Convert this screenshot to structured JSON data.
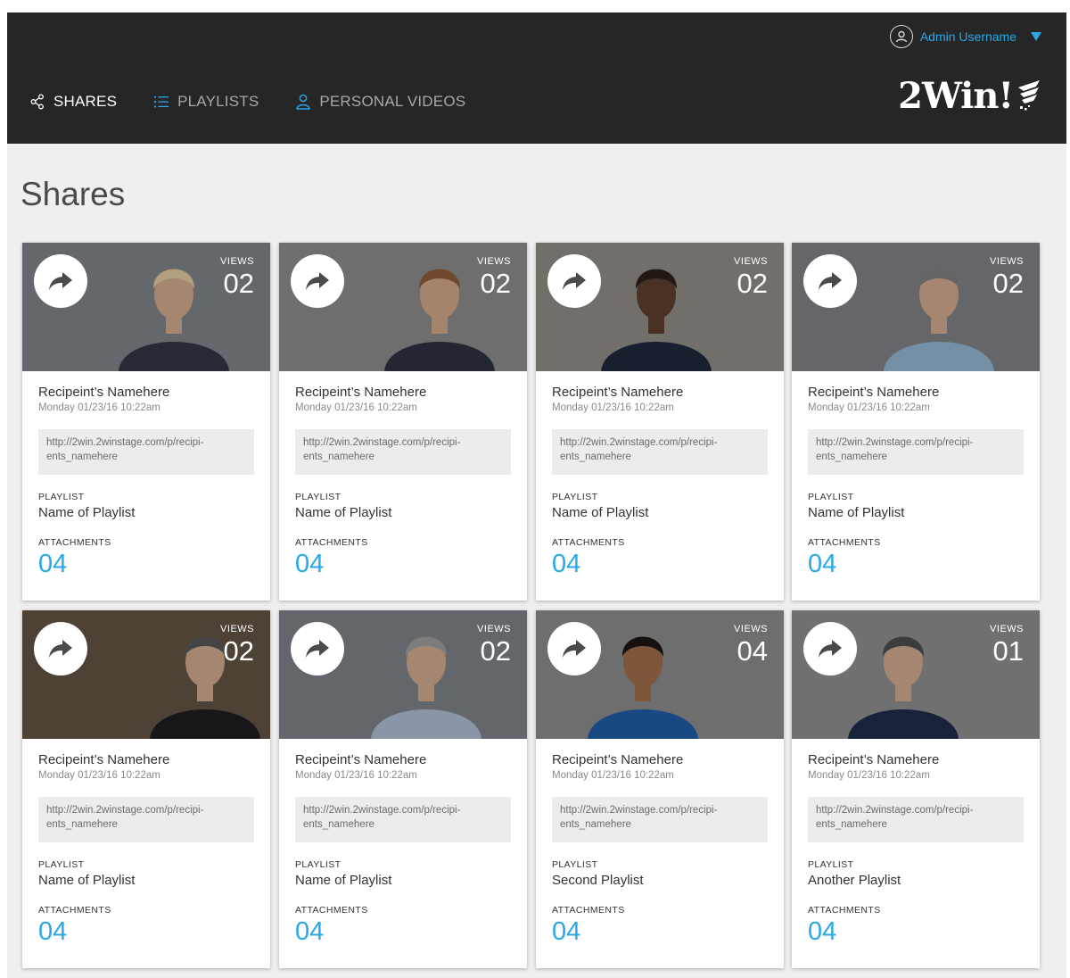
{
  "header": {
    "username": "Admin Username",
    "logo": "2Win!",
    "nav": [
      {
        "label": "SHARES",
        "icon": "share-icon",
        "active": true
      },
      {
        "label": "PLAYLISTS",
        "icon": "list-icon",
        "active": false
      },
      {
        "label": "PERSONAL VIDEOS",
        "icon": "person-icon",
        "active": false
      }
    ]
  },
  "page": {
    "title": "Shares"
  },
  "labels": {
    "views": "VIEWS",
    "playlist": "PLAYLIST",
    "attachments": "ATTACHMENTS"
  },
  "colors": {
    "header_bg": "#262626",
    "accent": "#2aa8e8",
    "page_bg": "#efefef"
  },
  "cards": [
    {
      "views": "02",
      "recipient": "Recipeint’s Namehere",
      "date": "Monday 01/23/16 10:22am",
      "url_line1": "http://2win.2winstage.com/p/recipi-",
      "url_line2": "ents_namehere",
      "playlist": "Name of Playlist",
      "attachments": "04"
    },
    {
      "views": "02",
      "recipient": "Recipeint’s Namehere",
      "date": "Monday 01/23/16 10:22am",
      "url_line1": "http://2win.2winstage.com/p/recipi-",
      "url_line2": "ents_namehere",
      "playlist": "Name of Playlist",
      "attachments": "04"
    },
    {
      "views": "02",
      "recipient": "Recipeint’s Namehere",
      "date": "Monday 01/23/16 10:22am",
      "url_line1": "http://2win.2winstage.com/p/recipi-",
      "url_line2": "ents_namehere",
      "playlist": "Name of Playlist",
      "attachments": "04"
    },
    {
      "views": "02",
      "recipient": "Recipeint’s Namehere",
      "date": "Monday 01/23/16 10:22am",
      "url_line1": "http://2win.2winstage.com/p/recipi-",
      "url_line2": "ents_namehere",
      "playlist": "Name of Playlist",
      "attachments": "04"
    },
    {
      "views": "02",
      "recipient": "Recipeint’s Namehere",
      "date": "Monday 01/23/16 10:22am",
      "url_line1": "http://2win.2winstage.com/p/recipi-",
      "url_line2": "ents_namehere",
      "playlist": "Name of Playlist",
      "attachments": "04"
    },
    {
      "views": "02",
      "recipient": "Recipeint’s Namehere",
      "date": "Monday 01/23/16 10:22am",
      "url_line1": "http://2win.2winstage.com/p/recipi-",
      "url_line2": "ents_namehere",
      "playlist": "Name of Playlist",
      "attachments": "04"
    },
    {
      "views": "04",
      "recipient": "Recipeint’s Namehere",
      "date": "Monday 01/23/16 10:22am",
      "url_line1": "http://2win.2winstage.com/p/recipi-",
      "url_line2": "ents_namehere",
      "playlist": "Second Playlist",
      "attachments": "04"
    },
    {
      "views": "01",
      "recipient": "Recipeint’s Namehere",
      "date": "Monday 01/23/16 10:22am",
      "url_line1": "http://2win.2winstage.com/p/recipi-",
      "url_line2": "ents_namehere",
      "playlist": "Another Playlist",
      "attachments": "04"
    }
  ]
}
